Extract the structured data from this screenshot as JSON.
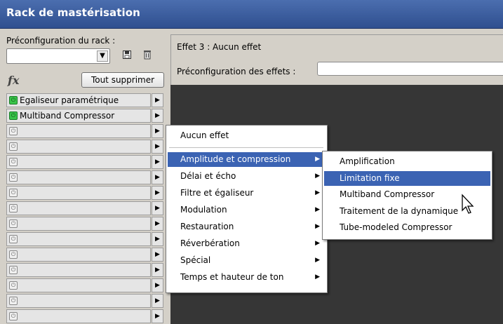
{
  "window": {
    "title": "Rack de mastérisation"
  },
  "rack": {
    "preset_label": "Préconfiguration du rack :",
    "preset_value": "",
    "fx_label": "fx",
    "clear_button": "Tout supprimer",
    "slots": [
      {
        "name": "Egaliseur paramétrique",
        "power": "on"
      },
      {
        "name": "Multiband Compressor",
        "power": "on"
      },
      {
        "name": "",
        "power": "off"
      },
      {
        "name": "",
        "power": "off"
      },
      {
        "name": "",
        "power": "off"
      },
      {
        "name": "",
        "power": "off"
      },
      {
        "name": "",
        "power": "off"
      },
      {
        "name": "",
        "power": "off"
      },
      {
        "name": "",
        "power": "off"
      },
      {
        "name": "",
        "power": "off"
      },
      {
        "name": "",
        "power": "off"
      },
      {
        "name": "",
        "power": "off"
      },
      {
        "name": "",
        "power": "off"
      },
      {
        "name": "",
        "power": "off"
      },
      {
        "name": "",
        "power": "off"
      }
    ]
  },
  "effect_panel": {
    "header": "Effet 3 : Aucun effet",
    "preset_label": "Préconfiguration des effets :",
    "preset_value": ""
  },
  "context_menu": {
    "items": [
      {
        "label": "Aucun effet",
        "submenu": false
      },
      {
        "label": "Amplitude et compression",
        "submenu": true,
        "highlighted": true
      },
      {
        "label": "Délai et écho",
        "submenu": true
      },
      {
        "label": "Filtre et égaliseur",
        "submenu": true
      },
      {
        "label": "Modulation",
        "submenu": true
      },
      {
        "label": "Restauration",
        "submenu": true
      },
      {
        "label": "Réverbération",
        "submenu": true
      },
      {
        "label": "Spécial",
        "submenu": true
      },
      {
        "label": "Temps et hauteur de ton",
        "submenu": true
      }
    ]
  },
  "submenu": {
    "items": [
      {
        "label": "Amplification"
      },
      {
        "label": "Limitation fixe",
        "highlighted": true
      },
      {
        "label": "Multiband Compressor"
      },
      {
        "label": "Traitement de la dynamique"
      },
      {
        "label": "Tube-modeled Compressor"
      }
    ]
  },
  "icons": {
    "power": "power-icon",
    "save": "save-icon",
    "delete": "trash-icon",
    "cursor": "mouse-pointer-icon"
  },
  "colors": {
    "title_bar": "#3d5f9f",
    "highlight": "#3b63b3",
    "power_on": "#39c44a",
    "panel_bg": "#363636"
  }
}
